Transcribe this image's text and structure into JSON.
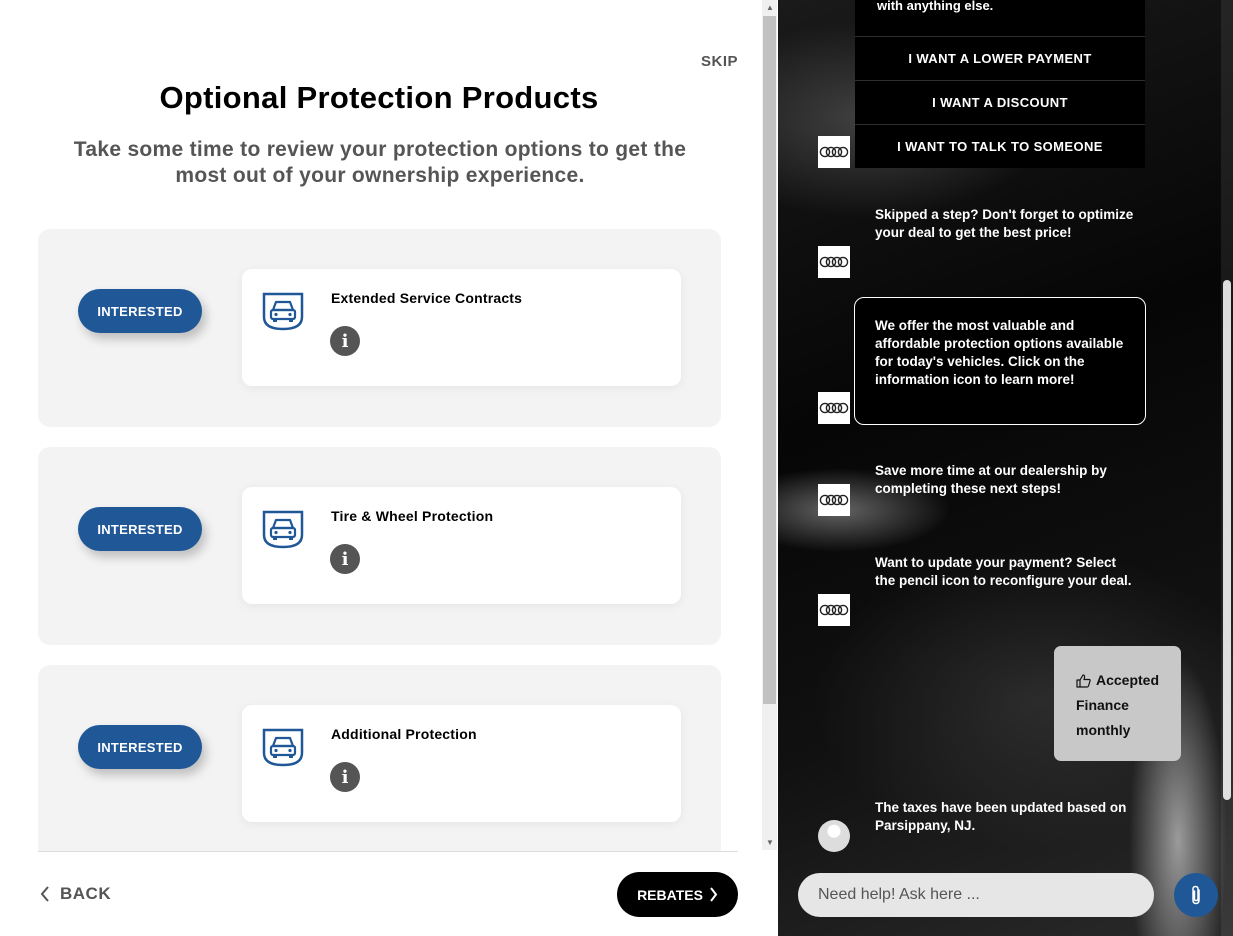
{
  "header": {
    "skip_label": "SKIP",
    "title": "Optional Protection Products",
    "subtitle": "Take some time to review your protection options to get the most out of your ownership experience."
  },
  "products": [
    {
      "name": "Extended Service Contracts",
      "button_label": "INTERESTED",
      "icon": "car-shield-icon"
    },
    {
      "name": "Tire & Wheel Protection",
      "button_label": "INTERESTED",
      "icon": "car-shield-icon"
    },
    {
      "name": "Additional Protection",
      "button_label": "INTERESTED",
      "icon": "car-shield-icon"
    }
  ],
  "footer": {
    "back_label": "BACK",
    "next_label": "REBATES"
  },
  "chat": {
    "partial_header": "with anything else.",
    "quick_replies": [
      "I WANT A LOWER PAYMENT",
      "I WANT A DISCOUNT",
      "I WANT TO TALK TO SOMEONE"
    ],
    "messages": [
      "Skipped a step? Don't forget to optimize your deal to get the best price!",
      "We offer the most valuable and affordable protection options available for today's vehicles. Click on the information icon to learn more!",
      "Save more time at our dealership by completing these next steps!",
      "Want to update your payment? Select the pencil icon to reconfigure your deal.",
      "The taxes have been updated based on Parsippany, NJ."
    ],
    "user_reply": {
      "line1": "Accepted",
      "line2": "Finance",
      "line3": "monthly",
      "icon": "thumbs-up-icon"
    },
    "input_placeholder": "Need help! Ask here ...",
    "attach_icon": "paperclip-icon"
  },
  "colors": {
    "brand_blue": "#1f5797",
    "card_bg": "#f3f3f3",
    "chat_bg": "#000000"
  }
}
